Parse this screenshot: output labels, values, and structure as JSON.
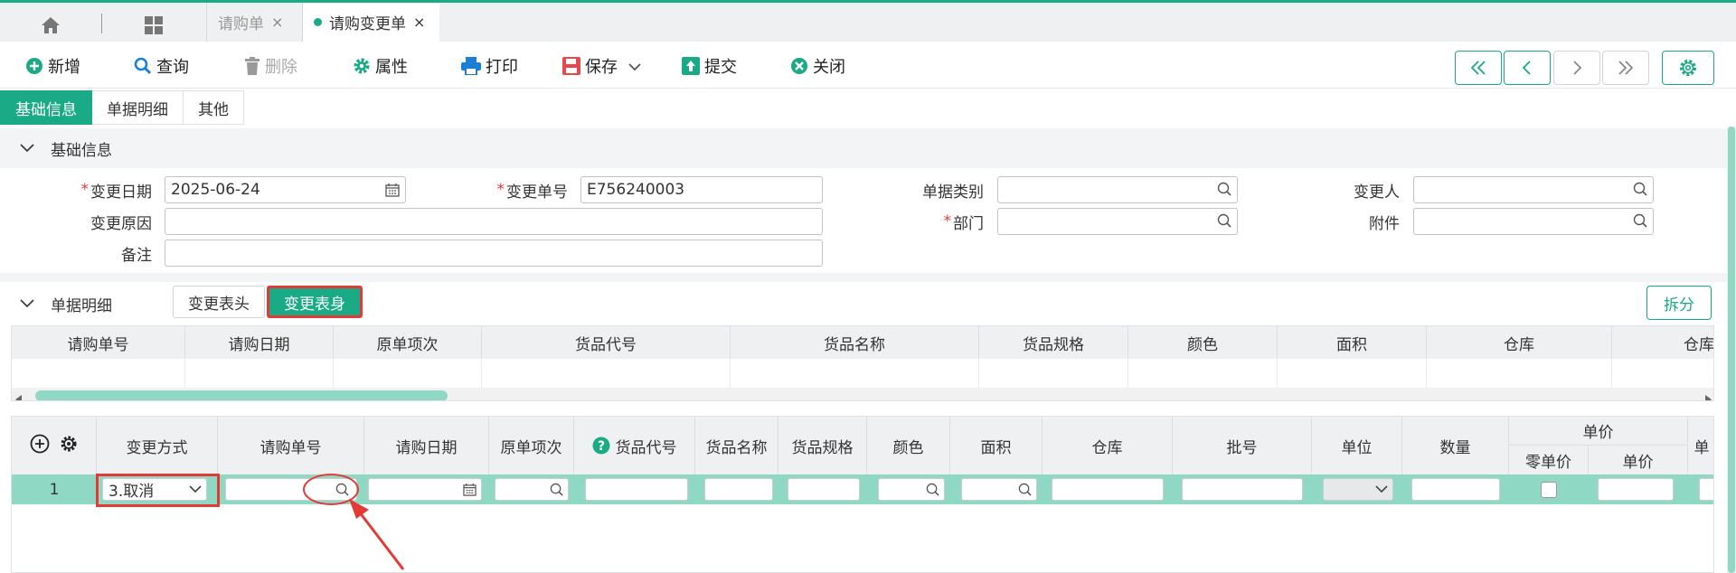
{
  "tabbar": {
    "tabs": [
      {
        "label": "请购单",
        "close": "×"
      },
      {
        "label": "请购变更单",
        "close": "×"
      }
    ]
  },
  "toolbar": {
    "new": "新增",
    "query": "查询",
    "delete": "删除",
    "properties": "属性",
    "print": "打印",
    "save": "保存",
    "submit": "提交",
    "close": "关闭"
  },
  "subtabs": [
    "基础信息",
    "单据明细",
    "其他"
  ],
  "basic_section": {
    "title": "基础信息"
  },
  "form": {
    "change_date": {
      "label": "变更日期",
      "required": "*",
      "value": "2025-06-24"
    },
    "change_no": {
      "label": "变更单号",
      "required": "*",
      "value": "E756240003"
    },
    "doc_type": {
      "label": "单据类别",
      "value": ""
    },
    "changer": {
      "label": "变更人",
      "value": ""
    },
    "change_reason": {
      "label": "变更原因",
      "value": ""
    },
    "department": {
      "label": "部门",
      "required": "*",
      "value": ""
    },
    "attachment": {
      "label": "附件",
      "value": ""
    },
    "remark": {
      "label": "备注",
      "value": ""
    }
  },
  "detail_section": {
    "title": "单据明细",
    "btn_header": "变更表头",
    "btn_body": "变更表身",
    "split": "拆分"
  },
  "grid1": {
    "columns": [
      "请购单号",
      "请购日期",
      "原单项次",
      "货品代号",
      "货品名称",
      "货品规格",
      "颜色",
      "面积",
      "仓库",
      "仓库名"
    ]
  },
  "grid2": {
    "columns": {
      "change_mode": "变更方式",
      "pr_no": "请购单号",
      "pr_date": "请购日期",
      "orig_item": "原单项次",
      "item_code": "货品代号",
      "item_name": "货品名称",
      "item_spec": "货品规格",
      "color": "颜色",
      "area": "面积",
      "warehouse": "仓库",
      "batch": "批号",
      "unit": "单位",
      "qty": "数量",
      "unit_price_group": "单价",
      "zero_price": "零单价",
      "unit_price": "单价",
      "last": "单"
    },
    "rows": [
      {
        "index": "1",
        "change_mode": "3.取消"
      }
    ]
  },
  "colors": {
    "accent": "#1aaa86",
    "row_highlight": "#8fd8c4",
    "annotation": "#e53935"
  }
}
